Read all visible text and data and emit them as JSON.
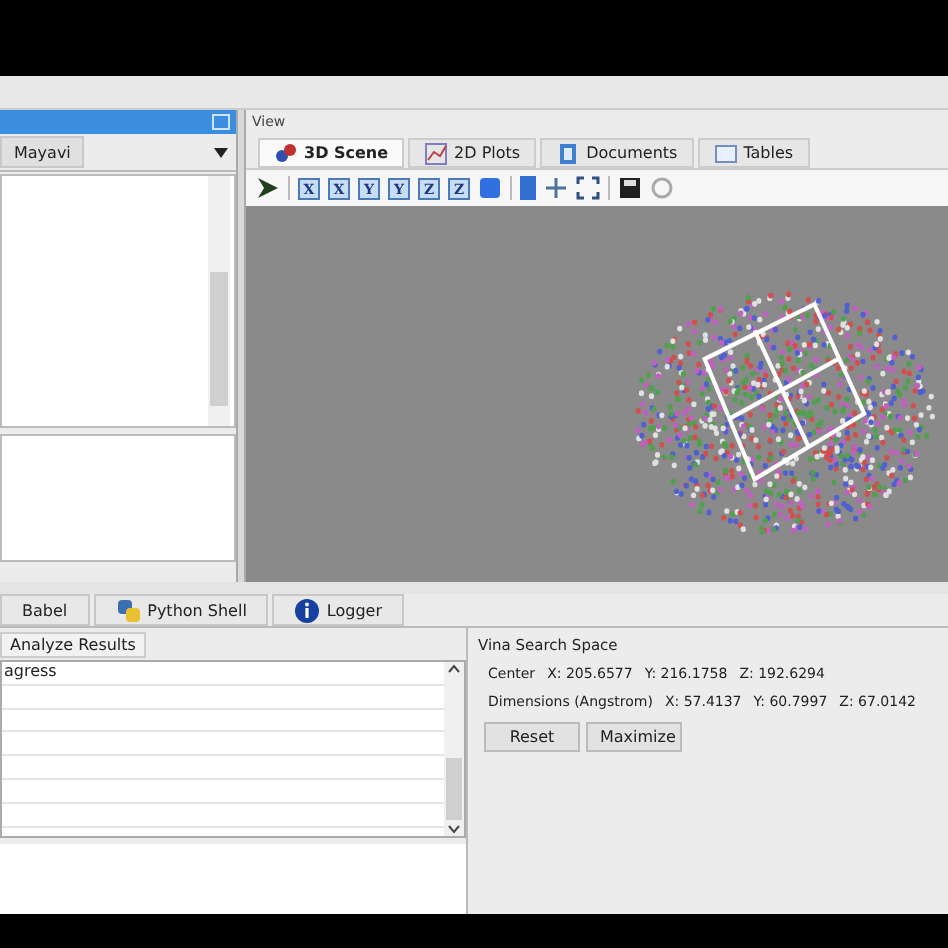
{
  "left_panel": {
    "tabs": [
      {
        "label": "Mayavi",
        "selected": true
      }
    ]
  },
  "view": {
    "title": "View",
    "tabs": [
      {
        "label": "3D Scene",
        "selected": true
      },
      {
        "label": "2D Plots",
        "selected": false
      },
      {
        "label": "Documents",
        "selected": false
      },
      {
        "label": "Tables",
        "selected": false
      }
    ],
    "axis_buttons": [
      "X",
      "X",
      "Y",
      "Y",
      "Z",
      "Z"
    ]
  },
  "bottom": {
    "tabs": [
      "Babel",
      "Python Shell",
      "Logger"
    ],
    "sub_tabs": [
      "Analyze Results"
    ],
    "list_rows": [
      "agress"
    ],
    "vina": {
      "title": "Vina Search Space",
      "center_label": "Center",
      "center": [
        "X: 205.6577",
        "Y: 216.1758",
        "Z: 192.6294"
      ],
      "dims_label": "Dimensions (Angstrom)",
      "dims": [
        "X: 57.4137",
        "Y: 60.7997",
        "Z: 67.0142"
      ],
      "buttons": [
        "Reset",
        "Maximize"
      ]
    }
  }
}
